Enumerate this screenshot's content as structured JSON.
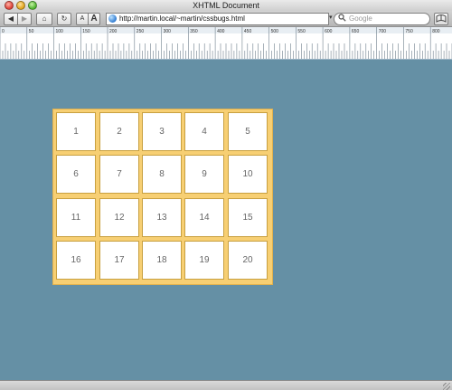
{
  "window": {
    "title": "XHTML Document"
  },
  "toolbar": {
    "back_label": "◀",
    "forward_label": "▶",
    "home_label": "⌂",
    "reload_label": "↻",
    "font_small_label": "A",
    "font_big_label": "A",
    "url": "http://martin.local/~martin/cssbugs.html",
    "url_dropdown": "▾",
    "search_placeholder": "Google",
    "search_icon": "magnifier-icon"
  },
  "ruler": {
    "labels": [
      "0",
      "50",
      "100",
      "150",
      "200",
      "250",
      "300",
      "350",
      "400",
      "450",
      "500",
      "550",
      "600",
      "650",
      "700",
      "750",
      "800"
    ]
  },
  "grid": {
    "cells": [
      "1",
      "2",
      "3",
      "4",
      "5",
      "6",
      "7",
      "8",
      "9",
      "10",
      "11",
      "12",
      "13",
      "14",
      "15",
      "16",
      "17",
      "18",
      "19",
      "20"
    ],
    "colors": {
      "frame": "#f7cf73",
      "cell_border": "#c8a040",
      "page_background": "#6590a5"
    }
  }
}
